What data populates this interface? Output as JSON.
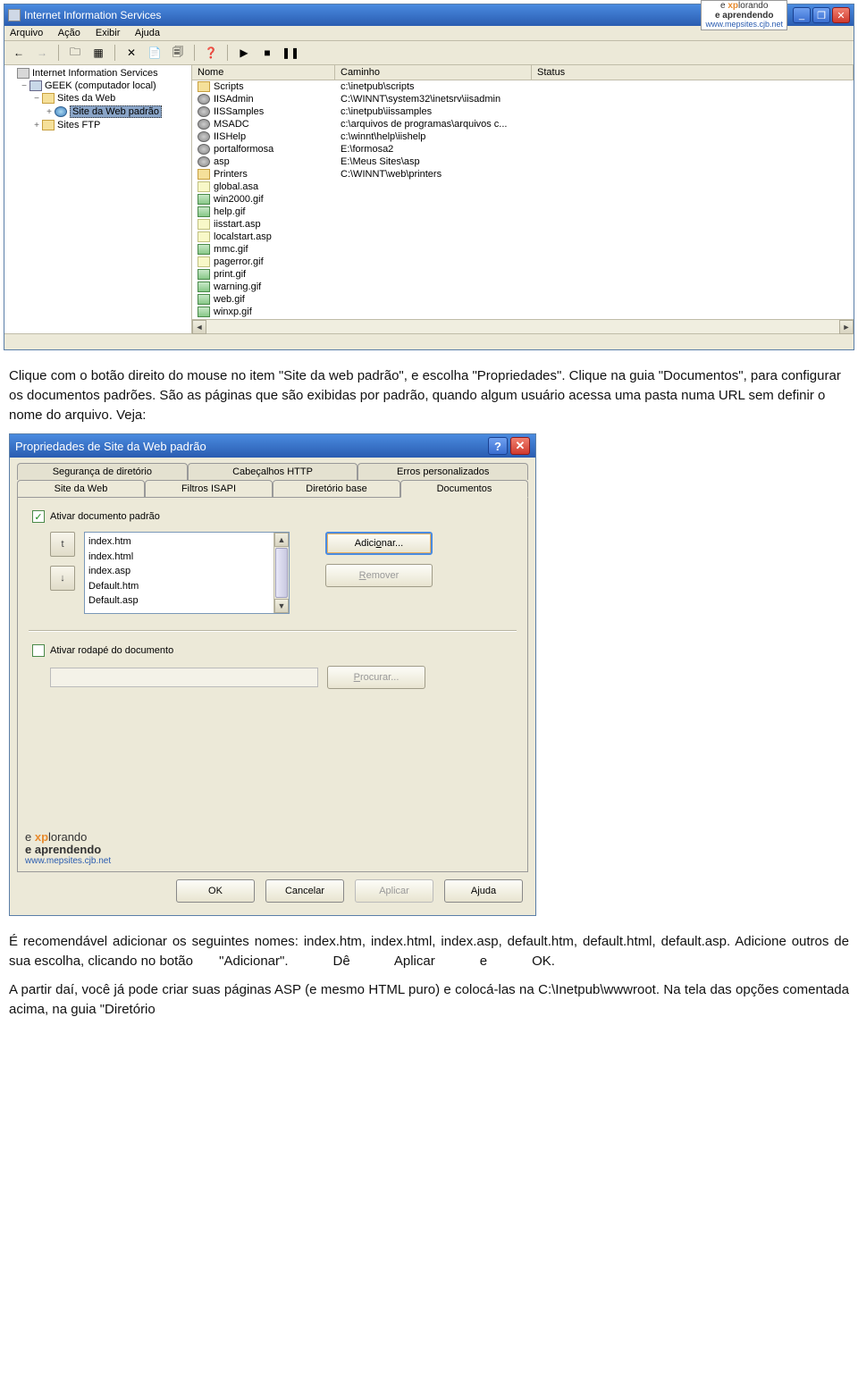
{
  "iis": {
    "title": "Internet Information Services",
    "logo": {
      "line1_a": "e ",
      "line1_b": "xp",
      "line1_c": "lorando",
      "line2": "e aprendendo",
      "url": "www.mepsites.cjb.net"
    },
    "winBtns": {
      "min": "_",
      "max": "❐",
      "close": "✕"
    },
    "menu": [
      "Arquivo",
      "Ação",
      "Exibir",
      "Ajuda"
    ],
    "tree": [
      {
        "indent": 0,
        "exp": "",
        "icon": "ico-server",
        "label": "Internet Information Services"
      },
      {
        "indent": 1,
        "exp": "−",
        "icon": "ico-comp",
        "label": "GEEK (computador local)"
      },
      {
        "indent": 2,
        "exp": "−",
        "icon": "ico-folder",
        "label": "Sites da Web"
      },
      {
        "indent": 3,
        "exp": "+",
        "icon": "ico-globe",
        "label": "Site da Web padrão",
        "sel": true
      },
      {
        "indent": 2,
        "exp": "+",
        "icon": "ico-folder",
        "label": "Sites FTP"
      }
    ],
    "cols": {
      "name": "Nome",
      "path": "Caminho",
      "status": "Status"
    },
    "rows": [
      {
        "ico": "ico-box",
        "name": "Scripts",
        "path": "c:\\inetpub\\scripts"
      },
      {
        "ico": "ico-gear",
        "name": "IISAdmin",
        "path": "C:\\WINNT\\system32\\inetsrv\\iisadmin"
      },
      {
        "ico": "ico-gear",
        "name": "IISSamples",
        "path": "c:\\inetpub\\iissamples"
      },
      {
        "ico": "ico-gear",
        "name": "MSADC",
        "path": "c:\\arquivos de programas\\arquivos c..."
      },
      {
        "ico": "ico-gear",
        "name": "IISHelp",
        "path": "c:\\winnt\\help\\iishelp"
      },
      {
        "ico": "ico-gear",
        "name": "portalformosa",
        "path": "E:\\formosa2"
      },
      {
        "ico": "ico-gear",
        "name": "asp",
        "path": "E:\\Meus Sites\\asp"
      },
      {
        "ico": "ico-box",
        "name": "Printers",
        "path": "C:\\WINNT\\web\\printers"
      },
      {
        "ico": "ico-asp",
        "name": "global.asa",
        "path": ""
      },
      {
        "ico": "ico-img",
        "name": "win2000.gif",
        "path": ""
      },
      {
        "ico": "ico-img",
        "name": "help.gif",
        "path": ""
      },
      {
        "ico": "ico-asp",
        "name": "iisstart.asp",
        "path": ""
      },
      {
        "ico": "ico-asp",
        "name": "localstart.asp",
        "path": ""
      },
      {
        "ico": "ico-img",
        "name": "mmc.gif",
        "path": ""
      },
      {
        "ico": "ico-asp",
        "name": "pagerror.gif",
        "path": ""
      },
      {
        "ico": "ico-img",
        "name": "print.gif",
        "path": ""
      },
      {
        "ico": "ico-img",
        "name": "warning.gif",
        "path": ""
      },
      {
        "ico": "ico-img",
        "name": "web.gif",
        "path": ""
      },
      {
        "ico": "ico-img",
        "name": "winxp.gif",
        "path": ""
      }
    ]
  },
  "para1": "Clique com o botão direito do mouse no item \"Site da web padrão\", e escolha \"Propriedades\". Clique na guia \"Documentos\", para configurar os documentos padrões. São as páginas que são exibidas por padrão, quando algum usuário acessa uma pasta numa URL sem definir o nome do arquivo. Veja:",
  "dlg": {
    "title": "Propriedades de Site da Web padrão",
    "help": "?",
    "close": "✕",
    "tabsTop": [
      "Segurança de diretório",
      "Cabeçalhos HTTP",
      "Erros personalizados"
    ],
    "tabsBot": [
      "Site da Web",
      "Filtros ISAPI",
      "Diretório base",
      "Documentos"
    ],
    "activeTab": 3,
    "chk1": "Ativar documento padrão",
    "docs": [
      "index.htm",
      "index.html",
      "index.asp",
      "Default.htm",
      "Default.asp"
    ],
    "btnAdd_a": "Adici",
    "btnAdd_u": "o",
    "btnAdd_b": "nar...",
    "btnRem_u": "R",
    "btnRem_b": "emover",
    "chk2": "Ativar rodapé do documento",
    "btnBrowse_u": "P",
    "btnBrowse_b": "rocurar...",
    "upGlyph": "t",
    "buttons": {
      "ok": "OK",
      "cancel": "Cancelar",
      "apply": "Aplicar",
      "help": "Ajuda"
    }
  },
  "para2": "É recomendável adicionar os seguintes nomes: index.htm, index.html, index.asp, default.htm, default.html, default.asp. Adicione outros de sua escolha, clicando no botão       \"Adicionar\".            Dê            Aplicar            e            OK.",
  "para3": "A partir daí, você já pode criar suas páginas ASP (e mesmo HTML puro) e colocá-las na C:\\Inetpub\\wwwroot. Na tela das opções comentada acima, na guia \"Diretório"
}
